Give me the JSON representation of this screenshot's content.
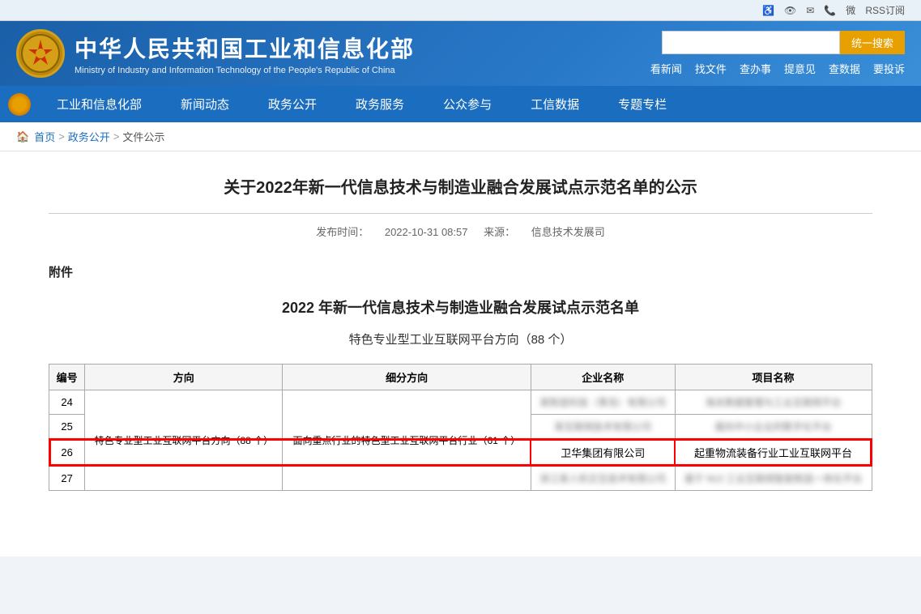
{
  "topbar": {
    "icons": [
      "accessibility-icon",
      "disability-icon",
      "mail-icon",
      "phone-icon",
      "weibo-icon",
      "rss-icon"
    ],
    "rss_label": "RSS订阅"
  },
  "header": {
    "emblem_text": "🌟",
    "title_cn": "中华人民共和国工业和信息化部",
    "title_en": "Ministry of Industry and Information Technology of the People's Republic of China",
    "search_placeholder": "",
    "search_btn": "统一搜索",
    "quick_links": [
      "看新闻",
      "找文件",
      "查办事",
      "提意见",
      "查数据",
      "要投诉"
    ]
  },
  "nav": {
    "items": [
      "工业和信息化部",
      "新闻动态",
      "政务公开",
      "政务服务",
      "公众参与",
      "工信数据",
      "专题专栏"
    ]
  },
  "breadcrumb": {
    "home": "首页",
    "sep1": ">",
    "link1": "政务公开",
    "sep2": ">",
    "current": "文件公示"
  },
  "article": {
    "title": "关于2022年新一代信息技术与制造业融合发展试点示范名单的公示",
    "publish_label": "发布时间：",
    "publish_date": "2022-10-31 08:57",
    "source_label": "来源：",
    "source": "信息技术发展司"
  },
  "attachment": {
    "label": "附件",
    "doc_title": "2022 年新一代信息技术与制造业融合发展试点示范名单",
    "section_title": "特色专业型工业互联网平台方向（88 个）"
  },
  "table": {
    "headers": [
      "编号",
      "方向",
      "细分方向",
      "企业名称",
      "项目名称"
    ],
    "rows": [
      {
        "num": "24",
        "direction": "特色专业型工业互联网平台方向（88 个）",
        "sub": "面向重点行业的特色型工业互联网平台行业（61 个）",
        "company_blurred": "某制造科技（青岛）有限公司",
        "project_blurred": "海关数据管理与工业互联网平台",
        "blurred": true
      },
      {
        "num": "25",
        "direction": "",
        "sub": "",
        "company_blurred": "某互联网技术有限公司",
        "project_blurred": "面向中小企业的数字化平台",
        "blurred": true
      },
      {
        "num": "26",
        "direction": "",
        "sub": "",
        "company": "卫华集团有限公司",
        "project": "起重物流装备行业工业互联网平台",
        "blurred": false,
        "highlight": true
      },
      {
        "num": "27",
        "direction": "",
        "sub": "",
        "company_blurred": "浙江某人机交互技术有限公司",
        "project_blurred": "基于 NUI 工业互联网智能制造一体化平台",
        "blurred": true
      }
    ]
  }
}
